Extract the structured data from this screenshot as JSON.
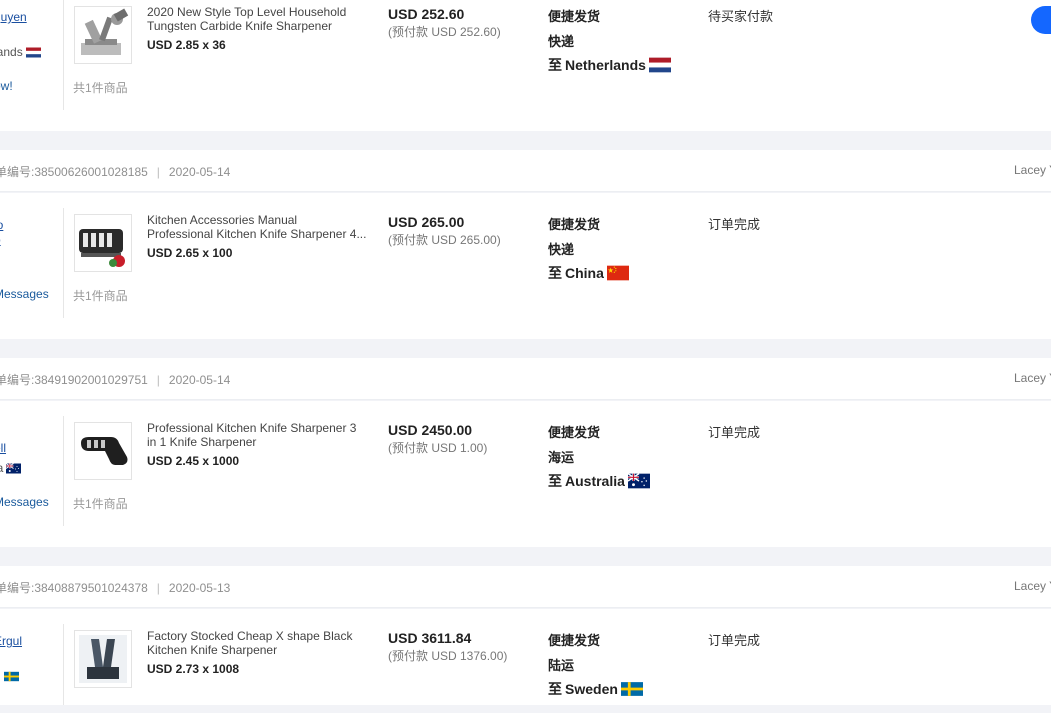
{
  "orders": [
    {
      "order_no": "",
      "date": "",
      "seller": "",
      "buyer": {
        "name": "guyen",
        "country": "lands",
        "flag": "netherlands",
        "link": "ow!"
      },
      "product": {
        "name_lines": [
          "2020 New Style Top Level Household",
          "Tungsten Carbide Knife Sharpener"
        ],
        "price_qty": "USD 2.85 x 36",
        "image": "knife-sharpener-tungsten"
      },
      "item_count": "共1件商品",
      "amount": "USD 252.60",
      "prepaid": "(预付款 USD 252.60)",
      "shipping_type": "便捷发货",
      "shipping_method": "快递",
      "destination_prefix": "至",
      "destination": "Netherlands",
      "destination_flag": "netherlands",
      "status": "待买家付款"
    },
    {
      "order_no": "单编号:38500626001028185",
      "date": "2020-05-14",
      "seller": "Lacey Y",
      "buyer": {
        "name": "io",
        "country": "o",
        "flag": "",
        "link": "Messages"
      },
      "product": {
        "name_lines": [
          "Kitchen Accessories Manual",
          "Professional Kitchen Knife Sharpener 4..."
        ],
        "price_qty": "USD 2.65 x 100",
        "image": "knife-sharpener-4-stage"
      },
      "item_count": "共1件商品",
      "amount": "USD 265.00",
      "prepaid": "(预付款 USD 265.00)",
      "shipping_type": "便捷发货",
      "shipping_method": "快递",
      "destination_prefix": "至",
      "destination": "China",
      "destination_flag": "china",
      "status": "订单完成"
    },
    {
      "order_no": "单编号:38491902001029751",
      "date": "2020-05-14",
      "seller": "Lacey Y",
      "buyer": {
        "name": "ell",
        "country": "ia",
        "flag": "australia",
        "link": "Messages"
      },
      "product": {
        "name_lines": [
          "Professional Kitchen Knife Sharpener 3",
          "in 1 Knife Sharpener"
        ],
        "price_qty": "USD 2.45 x 1000",
        "image": "knife-sharpener-3-in-1"
      },
      "item_count": "共1件商品",
      "amount": "USD 2450.00",
      "prepaid": "(预付款 USD 1.00)",
      "shipping_type": "便捷发货",
      "shipping_method": "海运",
      "destination_prefix": "至",
      "destination": "Australia",
      "destination_flag": "australia",
      "status": "订单完成"
    },
    {
      "order_no": "单编号:38408879501024378",
      "date": "2020-05-13",
      "seller": "Lacey Y",
      "buyer": {
        "name": "Ergul",
        "country": "n",
        "flag": "sweden",
        "link": ""
      },
      "product": {
        "name_lines": [
          "Factory Stocked Cheap X shape Black",
          "Kitchen Knife Sharpener"
        ],
        "price_qty": "USD 2.73 x 1008",
        "image": "knife-sharpener-x-shape"
      },
      "item_count": "",
      "amount": "USD 3611.84",
      "prepaid": "(预付款 USD 1376.00)",
      "shipping_type": "便捷发货",
      "shipping_method": "陆运",
      "destination_prefix": "至",
      "destination": "Sweden",
      "destination_flag": "sweden",
      "status": "订单完成"
    }
  ],
  "colors": {
    "page_bg": "#f2f3f7",
    "link": "#1a4fa0",
    "primary_button": "#1467ff"
  }
}
